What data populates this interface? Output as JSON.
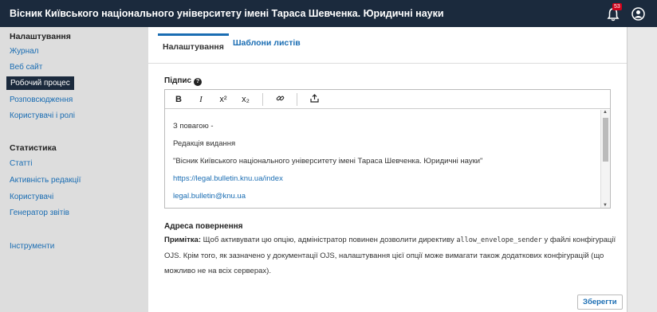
{
  "header": {
    "app_title": "Вісник Київського національного університету імені Тараса Шевченка. Юридичні науки",
    "notification_count": "53"
  },
  "sidebar": {
    "settings_heading": "Налаштування",
    "settings_items": [
      "Журнал",
      "Веб сайт",
      "Робочий процес",
      "Розповсюдження",
      "Користувачі і ролі"
    ],
    "stats_heading": "Статистика",
    "stats_items": [
      "Статті",
      "Активність редакції",
      "Користувачі",
      "Генератор звітів"
    ],
    "tools_label": "Інструменти"
  },
  "tabs": [
    "Налаштування",
    "Шаблони листів"
  ],
  "signature": {
    "label": "Підпис",
    "toolbar": {
      "bold": "B",
      "italic": "I",
      "superscript": "x²",
      "subscript": "x₂",
      "link": "🔗",
      "upload": "⇪"
    },
    "lines": [
      "З повагою -",
      "Редакція видання",
      "\"Вісник Київського національного університету імені Тараса Шевченка. Юридичні науки\"",
      "https://legal.bulletin.knu.ua/index",
      "legal.bulletin@knu.ua"
    ]
  },
  "return_address": {
    "title": "Адреса повернення",
    "note_label": "Примітка:",
    "note_text_1": "Щоб активувати цю опцію, адміністратор повинен дозволити директиву",
    "note_code": "allow_envelope_sender",
    "note_text_2": "у файлі конфігурації OJS. Крім того, як зазначено у документації OJS, налаштування цієї опції може вимагати також додаткових конфігурацій (що можливо не на всіх серверах)."
  },
  "save_label": "Зберегти",
  "colors": {
    "topbar": "#1b2a3d",
    "link": "#1a6db3",
    "badge": "#d0021b"
  }
}
